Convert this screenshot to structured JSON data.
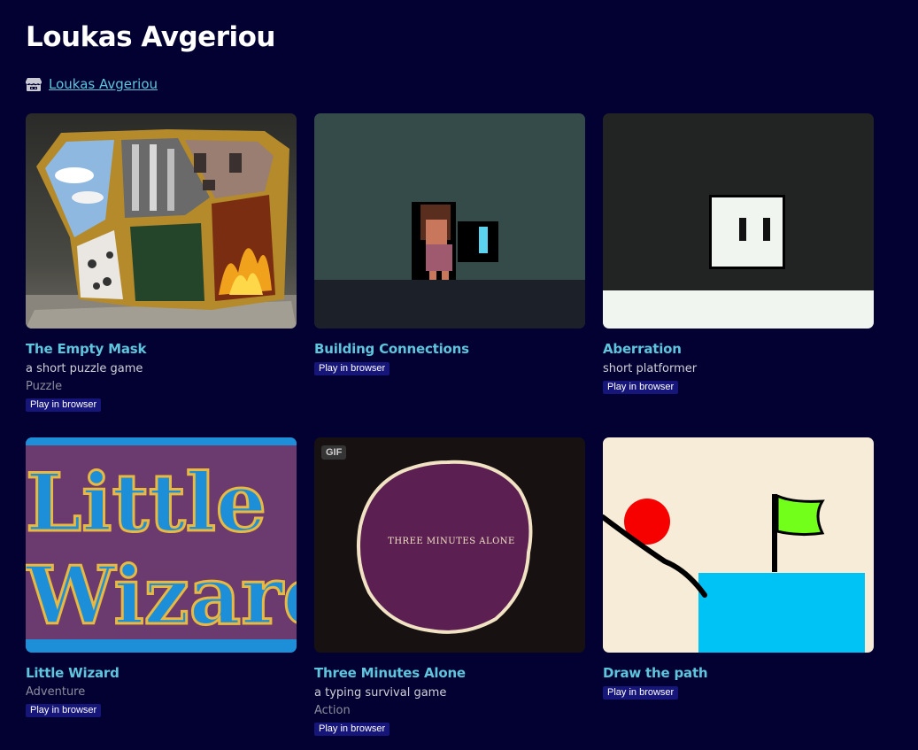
{
  "page": {
    "title": "Loukas Avgeriou"
  },
  "author": {
    "name": "Loukas Avgeriou",
    "icon": "itch-storefront-icon"
  },
  "games": [
    {
      "title": "The Empty Mask",
      "description": "a short puzzle game",
      "genre": "Puzzle",
      "badge": "Play in browser"
    },
    {
      "title": "Building Connections",
      "badge": "Play in browser"
    },
    {
      "title": "Aberration",
      "description": "short platformer",
      "badge": "Play in browser"
    },
    {
      "title": "Little Wizard",
      "genre": "Adventure",
      "badge": "Play in browser",
      "thumb_text": [
        "Little",
        "Wizard"
      ]
    },
    {
      "title": "Three Minutes Alone",
      "description": "a typing survival game",
      "genre": "Action",
      "badge": "Play in browser",
      "gif_label": "GIF",
      "thumb_text": "THREE MINUTES ALONE"
    },
    {
      "title": "Draw the path",
      "badge": "Play in browser"
    }
  ],
  "colors": {
    "background": "#020131",
    "link": "#5fc5dd",
    "badge": "#16157a"
  }
}
